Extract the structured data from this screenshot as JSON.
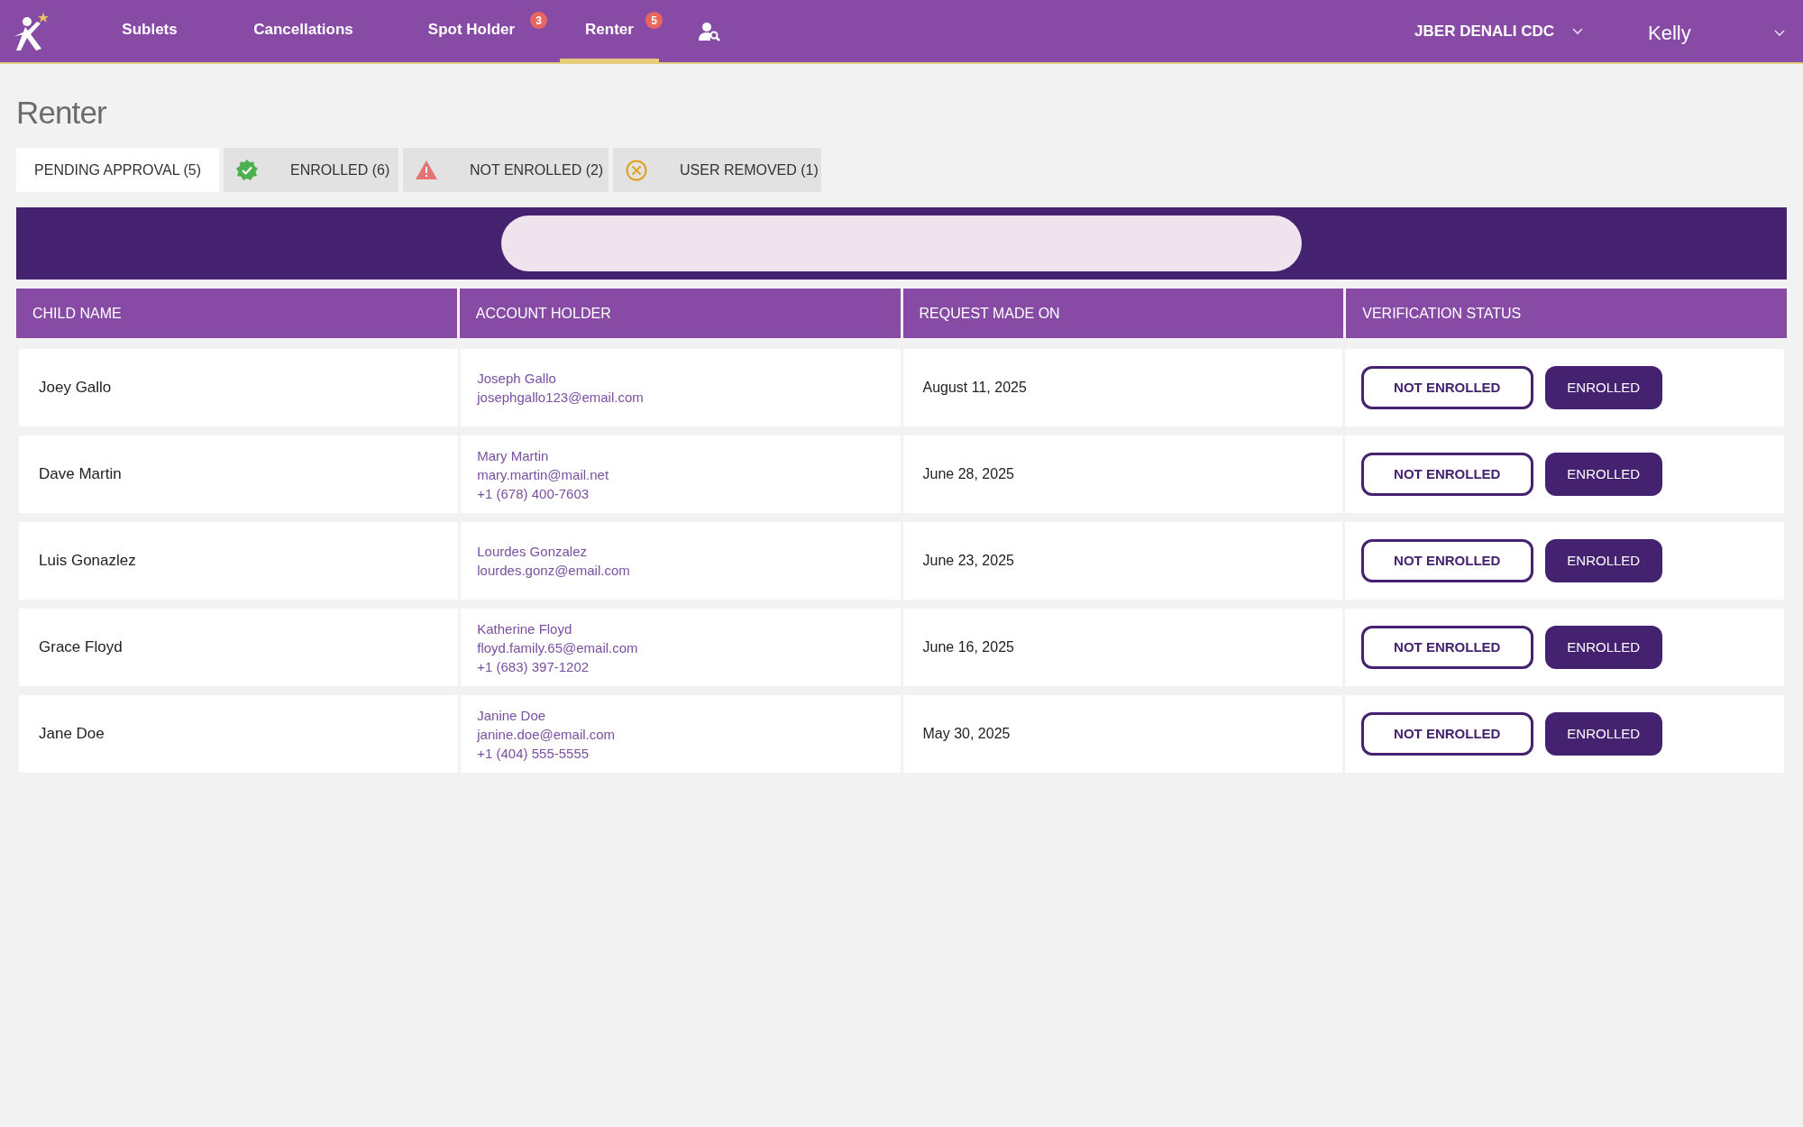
{
  "nav": {
    "items": [
      {
        "label": "Sublets",
        "selected": false
      },
      {
        "label": "Cancellations",
        "selected": false
      },
      {
        "label": "Spot Holder",
        "badge": "3",
        "selected": false
      },
      {
        "label": "Renter",
        "badge": "5",
        "selected": true
      }
    ],
    "center": "JBER DENALI CDC",
    "user": "Kelly"
  },
  "page_title": "Renter",
  "tabs": [
    {
      "label": "PENDING APPROVAL (5)",
      "kind": "pending",
      "selected": true
    },
    {
      "label": "ENROLLED (6)",
      "kind": "enrolled",
      "selected": false
    },
    {
      "label": "NOT ENROLLED (2)",
      "kind": "not_enrolled",
      "selected": false
    },
    {
      "label": "USER REMOVED (1)",
      "kind": "removed",
      "selected": false
    }
  ],
  "table": {
    "columns": [
      "CHILD NAME",
      "ACCOUNT HOLDER",
      "REQUEST MADE ON",
      "VERIFICATION STATUS"
    ],
    "rows": [
      {
        "child": "Joey Gallo",
        "holder": [
          "Joseph Gallo",
          "josephgallo123@email.com"
        ],
        "date": "August 11, 2025",
        "actions": [
          "NOT ENROLLED",
          "ENROLLED"
        ]
      },
      {
        "child": "Dave Martin",
        "holder": [
          "Mary Martin",
          "mary.martin@mail.net",
          "+1 (678) 400-7603"
        ],
        "date": "June 28, 2025",
        "actions": [
          "NOT ENROLLED",
          "ENROLLED"
        ]
      },
      {
        "child": "Luis Gonazlez",
        "holder": [
          "Lourdes Gonzalez",
          "lourdes.gonz@email.com"
        ],
        "date": "June 23, 2025",
        "actions": [
          "NOT ENROLLED",
          "ENROLLED"
        ]
      },
      {
        "child": "Grace Floyd",
        "holder": [
          "Katherine Floyd",
          "floyd.family.65@email.com",
          "+1 (683) 397-1202"
        ],
        "date": "June 16, 2025",
        "actions": [
          "NOT ENROLLED",
          "ENROLLED"
        ]
      },
      {
        "child": "Jane Doe",
        "holder": [
          "Janine Doe",
          "janine.doe@email.com",
          "+1 (404) 555-5555"
        ],
        "date": "May 30, 2025",
        "actions": [
          "NOT ENROLLED",
          "ENROLLED"
        ]
      }
    ]
  }
}
